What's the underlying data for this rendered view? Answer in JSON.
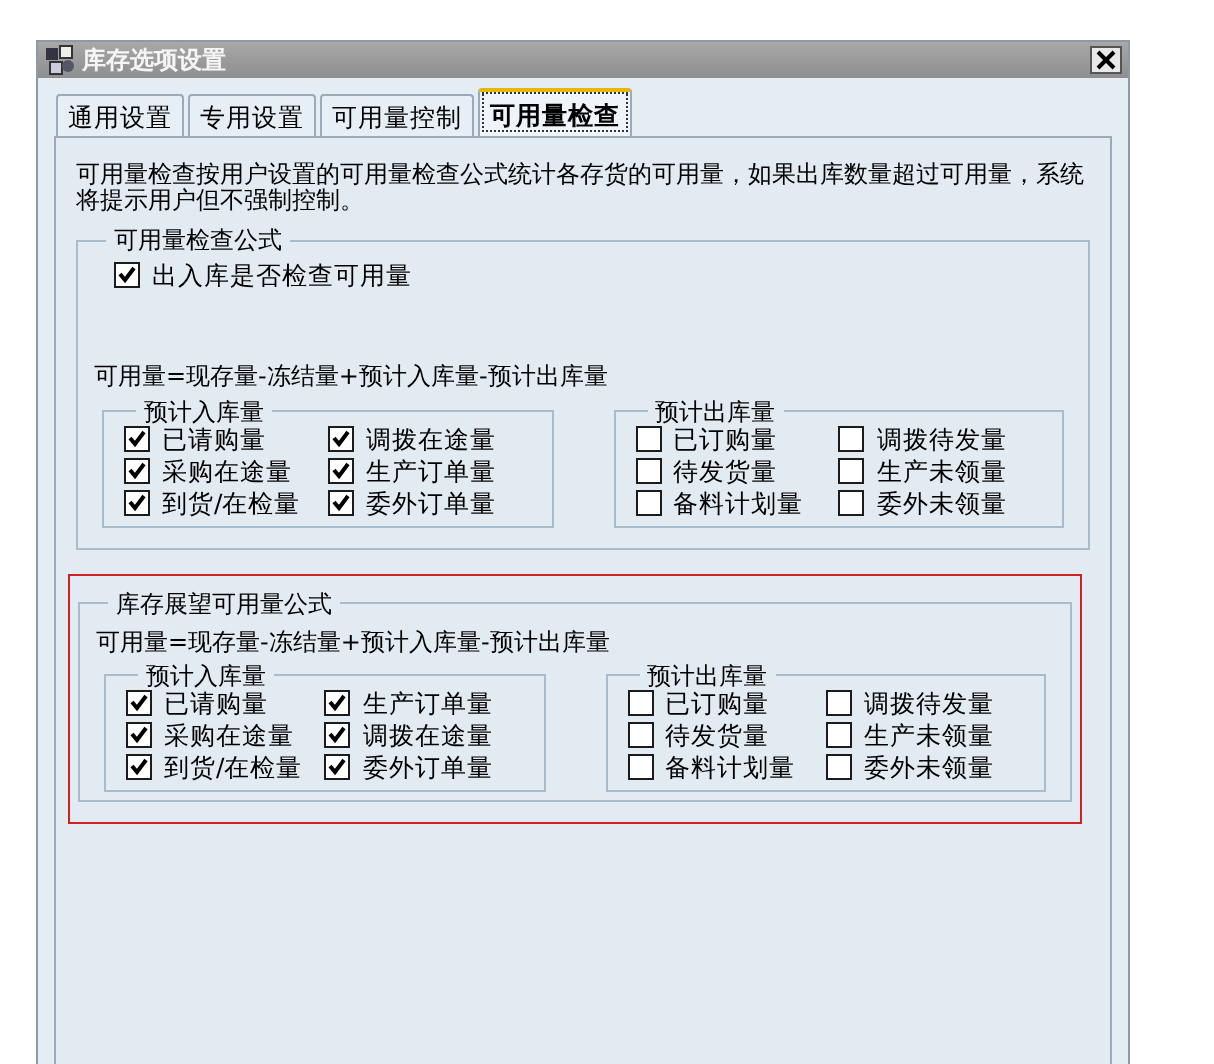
{
  "window": {
    "title": "库存选项设置"
  },
  "tabs": [
    {
      "label": "通用设置",
      "selected": false
    },
    {
      "label": "专用设置",
      "selected": false
    },
    {
      "label": "可用量控制",
      "selected": false
    },
    {
      "label": "可用量检查",
      "selected": true
    }
  ],
  "description": "可用量检查按用户设置的可用量检查公式统计各存货的可用量，如果出库数量超过可用量，系统将提示用户但不强制控制。",
  "sections": [
    {
      "title": "可用量检查公式",
      "highlighted": false,
      "toggle": {
        "label": "出入库是否检查可用量",
        "checked": true
      },
      "formula": "可用量=现存量-冻结量+预计入库量-预计出库量",
      "groups": [
        {
          "title": "预计入库量",
          "items": [
            {
              "label": "已请购量",
              "checked": true
            },
            {
              "label": "调拨在途量",
              "checked": true
            },
            {
              "label": "采购在途量",
              "checked": true
            },
            {
              "label": "生产订单量",
              "checked": true
            },
            {
              "label": "到货/在检量",
              "checked": true
            },
            {
              "label": "委外订单量",
              "checked": true
            }
          ]
        },
        {
          "title": "预计出库量",
          "items": [
            {
              "label": "已订购量",
              "checked": false
            },
            {
              "label": "调拨待发量",
              "checked": false
            },
            {
              "label": "待发货量",
              "checked": false
            },
            {
              "label": "生产未领量",
              "checked": false
            },
            {
              "label": "备料计划量",
              "checked": false
            },
            {
              "label": "委外未领量",
              "checked": false
            }
          ]
        }
      ]
    },
    {
      "title": "库存展望可用量公式",
      "highlighted": true,
      "formula": "可用量=现存量-冻结量+预计入库量-预计出库量",
      "groups": [
        {
          "title": "预计入库量",
          "items": [
            {
              "label": "已请购量",
              "checked": true
            },
            {
              "label": "生产订单量",
              "checked": true
            },
            {
              "label": "采购在途量",
              "checked": true
            },
            {
              "label": "调拨在途量",
              "checked": true
            },
            {
              "label": "到货/在检量",
              "checked": true
            },
            {
              "label": "委外订单量",
              "checked": true
            }
          ]
        },
        {
          "title": "预计出库量",
          "items": [
            {
              "label": "已订购量",
              "checked": false
            },
            {
              "label": "调拨待发量",
              "checked": false
            },
            {
              "label": "待发货量",
              "checked": false
            },
            {
              "label": "生产未领量",
              "checked": false
            },
            {
              "label": "备料计划量",
              "checked": false
            },
            {
              "label": "委外未领量",
              "checked": false
            }
          ]
        }
      ]
    }
  ]
}
